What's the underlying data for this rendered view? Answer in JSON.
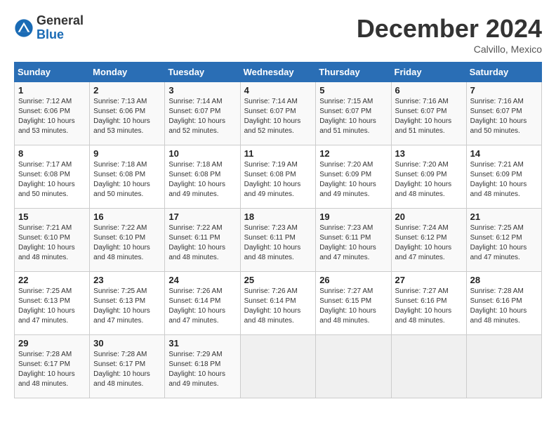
{
  "logo": {
    "general": "General",
    "blue": "Blue"
  },
  "title": "December 2024",
  "location": "Calvillo, Mexico",
  "days_of_week": [
    "Sunday",
    "Monday",
    "Tuesday",
    "Wednesday",
    "Thursday",
    "Friday",
    "Saturday"
  ],
  "weeks": [
    [
      {
        "day": "1",
        "detail": "Sunrise: 7:12 AM\nSunset: 6:06 PM\nDaylight: 10 hours\nand 53 minutes."
      },
      {
        "day": "2",
        "detail": "Sunrise: 7:13 AM\nSunset: 6:06 PM\nDaylight: 10 hours\nand 53 minutes."
      },
      {
        "day": "3",
        "detail": "Sunrise: 7:14 AM\nSunset: 6:07 PM\nDaylight: 10 hours\nand 52 minutes."
      },
      {
        "day": "4",
        "detail": "Sunrise: 7:14 AM\nSunset: 6:07 PM\nDaylight: 10 hours\nand 52 minutes."
      },
      {
        "day": "5",
        "detail": "Sunrise: 7:15 AM\nSunset: 6:07 PM\nDaylight: 10 hours\nand 51 minutes."
      },
      {
        "day": "6",
        "detail": "Sunrise: 7:16 AM\nSunset: 6:07 PM\nDaylight: 10 hours\nand 51 minutes."
      },
      {
        "day": "7",
        "detail": "Sunrise: 7:16 AM\nSunset: 6:07 PM\nDaylight: 10 hours\nand 50 minutes."
      }
    ],
    [
      {
        "day": "8",
        "detail": "Sunrise: 7:17 AM\nSunset: 6:08 PM\nDaylight: 10 hours\nand 50 minutes."
      },
      {
        "day": "9",
        "detail": "Sunrise: 7:18 AM\nSunset: 6:08 PM\nDaylight: 10 hours\nand 50 minutes."
      },
      {
        "day": "10",
        "detail": "Sunrise: 7:18 AM\nSunset: 6:08 PM\nDaylight: 10 hours\nand 49 minutes."
      },
      {
        "day": "11",
        "detail": "Sunrise: 7:19 AM\nSunset: 6:08 PM\nDaylight: 10 hours\nand 49 minutes."
      },
      {
        "day": "12",
        "detail": "Sunrise: 7:20 AM\nSunset: 6:09 PM\nDaylight: 10 hours\nand 49 minutes."
      },
      {
        "day": "13",
        "detail": "Sunrise: 7:20 AM\nSunset: 6:09 PM\nDaylight: 10 hours\nand 48 minutes."
      },
      {
        "day": "14",
        "detail": "Sunrise: 7:21 AM\nSunset: 6:09 PM\nDaylight: 10 hours\nand 48 minutes."
      }
    ],
    [
      {
        "day": "15",
        "detail": "Sunrise: 7:21 AM\nSunset: 6:10 PM\nDaylight: 10 hours\nand 48 minutes."
      },
      {
        "day": "16",
        "detail": "Sunrise: 7:22 AM\nSunset: 6:10 PM\nDaylight: 10 hours\nand 48 minutes."
      },
      {
        "day": "17",
        "detail": "Sunrise: 7:22 AM\nSunset: 6:11 PM\nDaylight: 10 hours\nand 48 minutes."
      },
      {
        "day": "18",
        "detail": "Sunrise: 7:23 AM\nSunset: 6:11 PM\nDaylight: 10 hours\nand 48 minutes."
      },
      {
        "day": "19",
        "detail": "Sunrise: 7:23 AM\nSunset: 6:11 PM\nDaylight: 10 hours\nand 47 minutes."
      },
      {
        "day": "20",
        "detail": "Sunrise: 7:24 AM\nSunset: 6:12 PM\nDaylight: 10 hours\nand 47 minutes."
      },
      {
        "day": "21",
        "detail": "Sunrise: 7:25 AM\nSunset: 6:12 PM\nDaylight: 10 hours\nand 47 minutes."
      }
    ],
    [
      {
        "day": "22",
        "detail": "Sunrise: 7:25 AM\nSunset: 6:13 PM\nDaylight: 10 hours\nand 47 minutes."
      },
      {
        "day": "23",
        "detail": "Sunrise: 7:25 AM\nSunset: 6:13 PM\nDaylight: 10 hours\nand 47 minutes."
      },
      {
        "day": "24",
        "detail": "Sunrise: 7:26 AM\nSunset: 6:14 PM\nDaylight: 10 hours\nand 47 minutes."
      },
      {
        "day": "25",
        "detail": "Sunrise: 7:26 AM\nSunset: 6:14 PM\nDaylight: 10 hours\nand 48 minutes."
      },
      {
        "day": "26",
        "detail": "Sunrise: 7:27 AM\nSunset: 6:15 PM\nDaylight: 10 hours\nand 48 minutes."
      },
      {
        "day": "27",
        "detail": "Sunrise: 7:27 AM\nSunset: 6:16 PM\nDaylight: 10 hours\nand 48 minutes."
      },
      {
        "day": "28",
        "detail": "Sunrise: 7:28 AM\nSunset: 6:16 PM\nDaylight: 10 hours\nand 48 minutes."
      }
    ],
    [
      {
        "day": "29",
        "detail": "Sunrise: 7:28 AM\nSunset: 6:17 PM\nDaylight: 10 hours\nand 48 minutes."
      },
      {
        "day": "30",
        "detail": "Sunrise: 7:28 AM\nSunset: 6:17 PM\nDaylight: 10 hours\nand 48 minutes."
      },
      {
        "day": "31",
        "detail": "Sunrise: 7:29 AM\nSunset: 6:18 PM\nDaylight: 10 hours\nand 49 minutes."
      },
      {
        "day": "",
        "detail": ""
      },
      {
        "day": "",
        "detail": ""
      },
      {
        "day": "",
        "detail": ""
      },
      {
        "day": "",
        "detail": ""
      }
    ]
  ]
}
